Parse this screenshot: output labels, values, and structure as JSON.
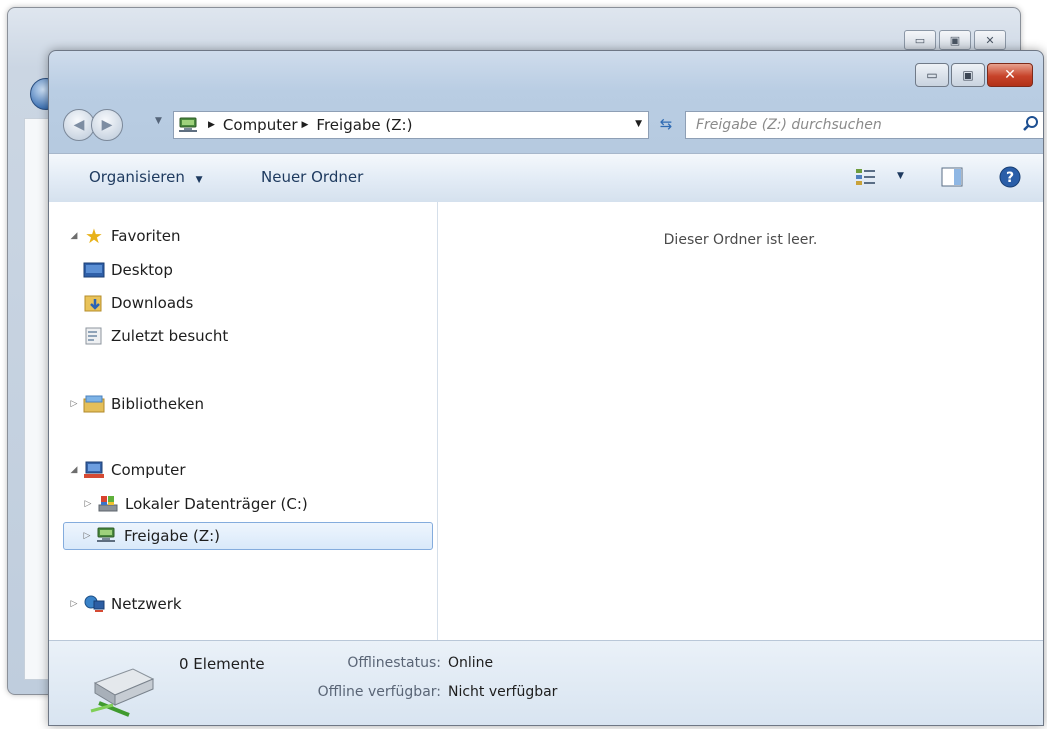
{
  "main_window": {
    "address": {
      "crumbs": [
        "Computer",
        "Freigabe (Z:)"
      ]
    },
    "search": {
      "placeholder": "Freigabe (Z:) durchsuchen"
    },
    "toolbar": {
      "organize_label": "Organisieren",
      "new_folder_label": "Neuer Ordner"
    },
    "nav_pane": {
      "favorites": {
        "label": "Favoriten",
        "items": [
          "Desktop",
          "Downloads",
          "Zuletzt besucht"
        ]
      },
      "libraries": {
        "label": "Bibliotheken"
      },
      "computer": {
        "label": "Computer",
        "items": [
          "Lokaler Datenträger (C:)",
          "Freigabe (Z:)"
        ]
      },
      "network": {
        "label": "Netzwerk"
      }
    },
    "content": {
      "empty_message": "Dieser Ordner ist leer."
    },
    "details": {
      "count": "0 Elemente",
      "offline_status_label": "Offlinestatus:",
      "offline_status_value": "Online",
      "offline_available_label": "Offline verfügbar:",
      "offline_available_value": "Nicht verfügbar"
    }
  },
  "colors": {
    "selection_border": "#84acdd",
    "close_button": "#c7432a",
    "toolbar_text": "#1e3a5f"
  }
}
